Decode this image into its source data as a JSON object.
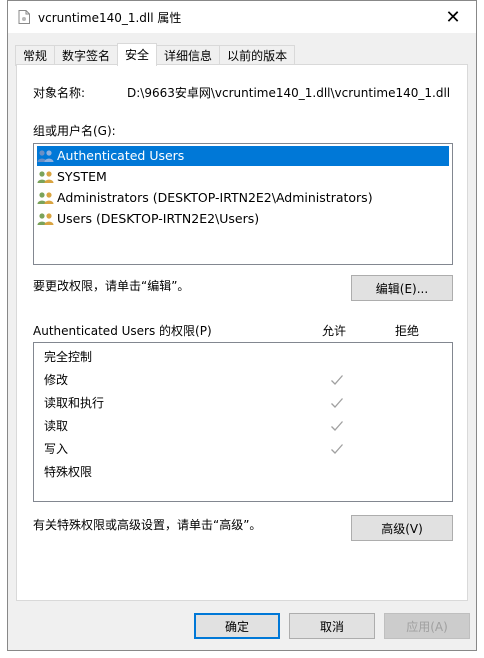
{
  "window": {
    "title": "vcruntime140_1.dll 属性"
  },
  "tabs": [
    {
      "label": "常规",
      "active": false
    },
    {
      "label": "数字签名",
      "active": false
    },
    {
      "label": "安全",
      "active": true
    },
    {
      "label": "详细信息",
      "active": false
    },
    {
      "label": "以前的版本",
      "active": false
    }
  ],
  "security": {
    "object_name_label": "对象名称:",
    "object_name_value": "D:\\9663安卓网\\vcruntime140_1.dll\\vcruntime140_1.dll",
    "group_label": "组或用户名(G):",
    "users": [
      {
        "name": "Authenticated Users",
        "selected": true
      },
      {
        "name": "SYSTEM",
        "selected": false
      },
      {
        "name": "Administrators (DESKTOP-IRTN2E2\\Administrators)",
        "selected": false
      },
      {
        "name": "Users (DESKTOP-IRTN2E2\\Users)",
        "selected": false
      }
    ],
    "change_hint": "要更改权限，请单击“编辑”。",
    "edit_button": "编辑(E)...",
    "perm_header": "Authenticated Users 的权限(P)",
    "allow_header": "允许",
    "deny_header": "拒绝",
    "permissions": [
      {
        "name": "完全控制",
        "allow": false
      },
      {
        "name": "修改",
        "allow": true
      },
      {
        "name": "读取和执行",
        "allow": true
      },
      {
        "name": "读取",
        "allow": true
      },
      {
        "name": "写入",
        "allow": true
      },
      {
        "name": "特殊权限",
        "allow": false
      }
    ],
    "advanced_hint": "有关特殊权限或高级设置，请单击“高级”。",
    "advanced_button": "高级(V)"
  },
  "footer": {
    "ok": "确定",
    "cancel": "取消",
    "apply": "应用(A)"
  },
  "colors": {
    "selection": "#0078d7",
    "check": "#a0a0a0"
  }
}
